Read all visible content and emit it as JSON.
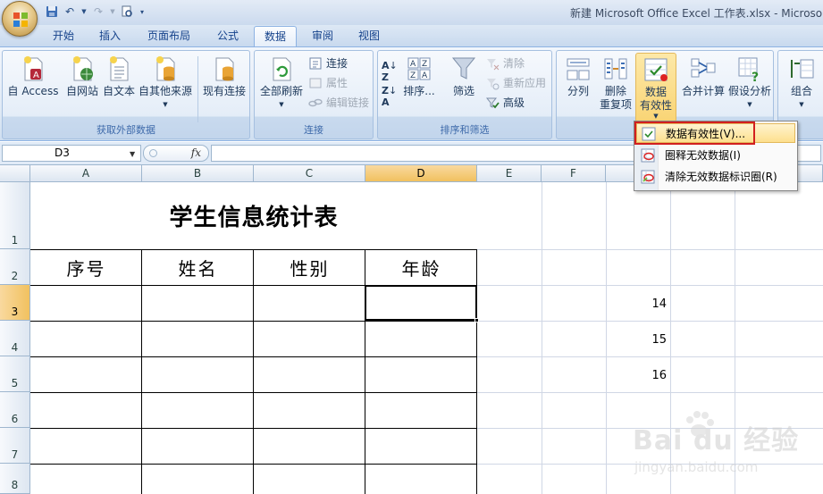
{
  "window": {
    "title": "新建 Microsoft Office Excel 工作表.xlsx - Microso"
  },
  "tabs": [
    {
      "label": "开始",
      "active": false
    },
    {
      "label": "插入",
      "active": false
    },
    {
      "label": "页面布局",
      "active": false
    },
    {
      "label": "公式",
      "active": false
    },
    {
      "label": "数据",
      "active": true
    },
    {
      "label": "审阅",
      "active": false
    },
    {
      "label": "视图",
      "active": false
    }
  ],
  "ribbon": {
    "get_external": {
      "group_label": "获取外部数据",
      "buttons": [
        "自 Access",
        "自网站",
        "自文本",
        "自其他来源",
        "现有连接"
      ]
    },
    "connections": {
      "group_label": "连接",
      "refresh_all": "全部刷新",
      "connections": "连接",
      "properties": "属性",
      "edit_links": "编辑链接"
    },
    "sort_filter": {
      "group_label": "排序和筛选",
      "sort": "排序...",
      "filter": "筛选",
      "clear": "清除",
      "reapply": "重新应用",
      "advanced": "高级"
    },
    "data_tools": {
      "split": "分列",
      "remove_dup_1": "删除",
      "remove_dup_2": "重复项",
      "validation_1": "数据",
      "validation_2": "有效性",
      "consolidate": "合并计算",
      "what_if": "假设分析"
    },
    "outline": {
      "group": "组合"
    }
  },
  "formula_bar": {
    "name_box": "D3",
    "fx_label": "fx",
    "formula": ""
  },
  "sheet": {
    "columns": [
      "A",
      "B",
      "C",
      "D",
      "E",
      "F",
      "",
      ""
    ],
    "selected_column": "D",
    "rows": [
      "1",
      "2",
      "3",
      "4",
      "5",
      "6",
      "7",
      "8"
    ],
    "selected_row": "3",
    "title": "学生信息统计表",
    "headers": [
      "序号",
      "姓名",
      "性别",
      "年龄"
    ],
    "side_numbers": [
      "14",
      "15",
      "16"
    ]
  },
  "dropdown_menu": {
    "items": [
      {
        "label": "数据有效性(V)...",
        "highlighted": true
      },
      {
        "label": "圈释无效数据(I)",
        "highlighted": false
      },
      {
        "label": "清除无效数据标识圈(R)",
        "highlighted": false
      }
    ]
  },
  "watermark": {
    "brand": "Bai du 经验",
    "url": "jingyan.baidu.com"
  }
}
